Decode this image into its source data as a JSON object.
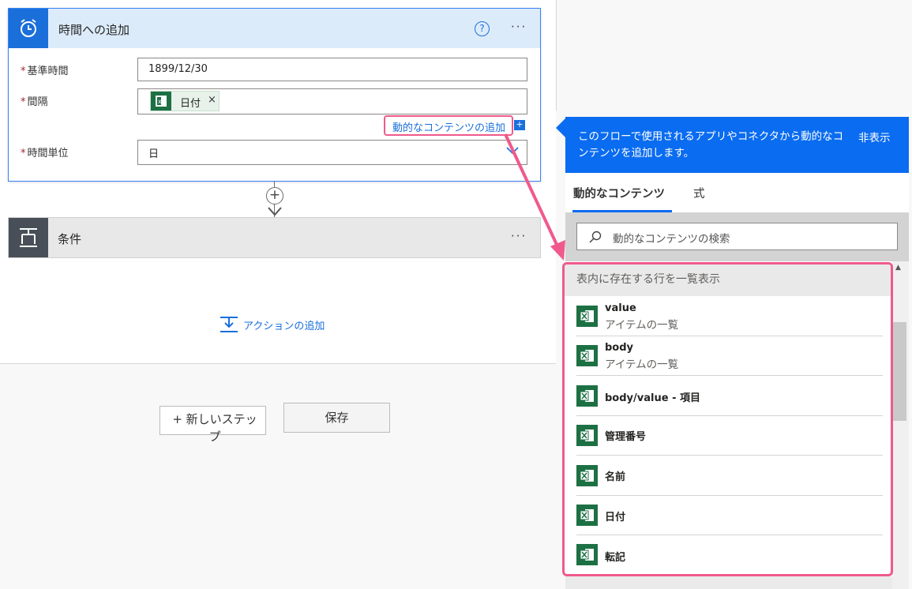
{
  "card_time": {
    "title": "時間への追加",
    "help": "?",
    "more": "···",
    "fields": {
      "base_time": {
        "label": "基準時間",
        "value": "1899/12/30"
      },
      "interval": {
        "label": "間隔",
        "token": "日付",
        "token_close": "×"
      },
      "unit": {
        "label": "時間単位",
        "value": "日"
      }
    },
    "dynamic_link": "動的なコンテンツの追加",
    "dynamic_plus": "+"
  },
  "connector": {
    "plus": "+"
  },
  "card_condition": {
    "title": "条件",
    "more": "···"
  },
  "add_action": "アクションの追加",
  "buttons": {
    "new_step": "+ 新しいステップ",
    "save": "保存"
  },
  "panel": {
    "description": "このフローで使用されるアプリやコネクタから動的なコンテンツを追加します。",
    "hide": "非表示",
    "tabs": [
      {
        "label": "動的なコンテンツ",
        "active": true
      },
      {
        "label": "式",
        "active": false
      }
    ],
    "search_placeholder": "動的なコンテンツの検索",
    "section_title": "表内に存在する行を一覧表示",
    "items": [
      {
        "name": "value",
        "sub": "アイテムの一覧"
      },
      {
        "name": "body",
        "sub": "アイテムの一覧"
      },
      {
        "name": "body/value - 項目",
        "sub": ""
      },
      {
        "name": "管理番号",
        "sub": ""
      },
      {
        "name": "名前",
        "sub": ""
      },
      {
        "name": "日付",
        "sub": ""
      },
      {
        "name": "転記",
        "sub": ""
      }
    ]
  },
  "colors": {
    "accent": "#1a6fdb",
    "panel_header": "#0a6cf0",
    "excel": "#1d7044",
    "highlight": "#f05a8b"
  }
}
